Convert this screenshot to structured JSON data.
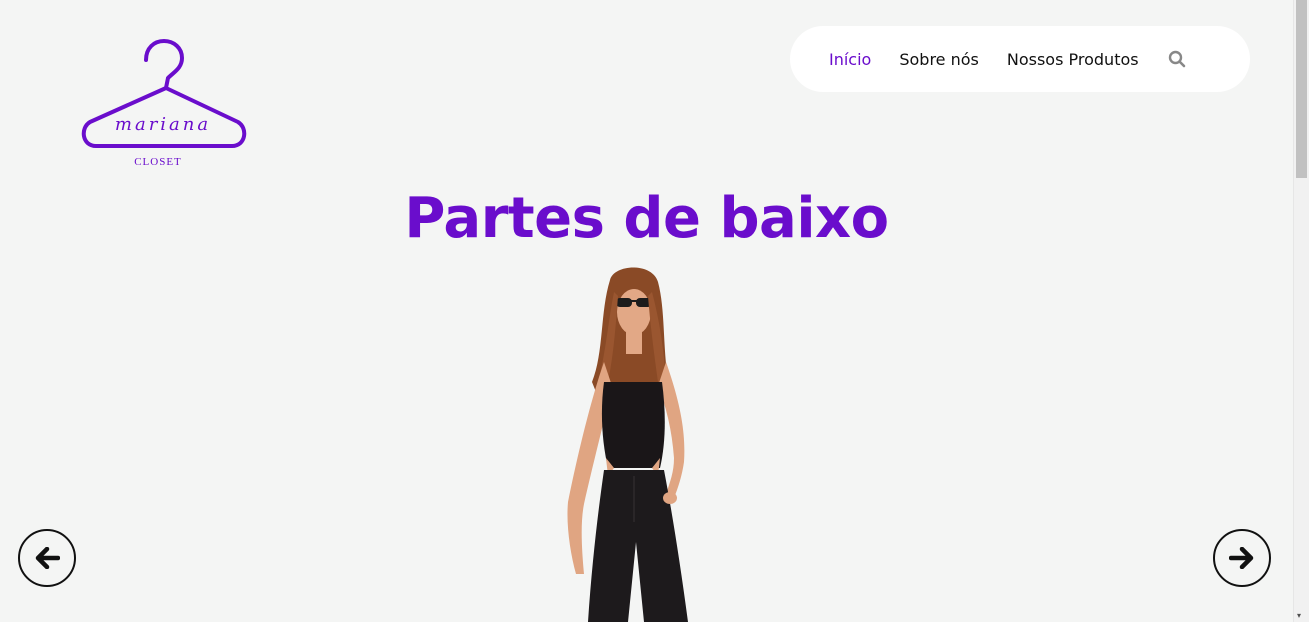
{
  "logo": {
    "script_text": "mariana",
    "sub_text": "CLOSET"
  },
  "nav": {
    "items": [
      {
        "label": "Início",
        "active": true
      },
      {
        "label": "Sobre nós",
        "active": false
      },
      {
        "label": "Nossos Produtos",
        "active": false
      }
    ],
    "search_icon": "search-icon"
  },
  "hero": {
    "title": "Partes de baixo"
  },
  "carousel": {
    "prev_icon": "arrow-left-icon",
    "next_icon": "arrow-right-icon"
  },
  "colors": {
    "accent": "#6a0dcc",
    "background": "#f4f5f4",
    "nav_background": "#ffffff"
  }
}
